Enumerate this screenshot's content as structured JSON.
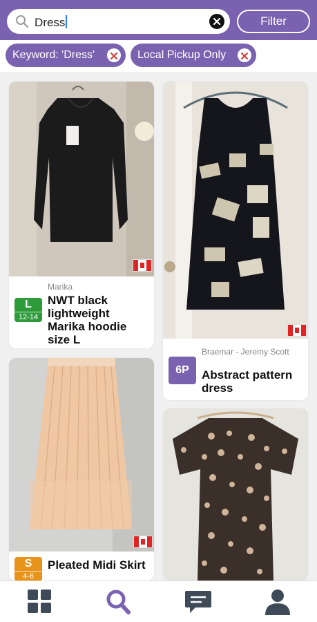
{
  "search": {
    "value": "Dress",
    "filter_label": "Filter"
  },
  "chips": [
    {
      "label": "Keyword: 'Dress'"
    },
    {
      "label": "Local Pickup Only"
    }
  ],
  "listings": [
    {
      "brand": "Marika",
      "title": "NWT black lightweight Marika hoodie size L",
      "size": "L",
      "size_range": "12-14",
      "badge_color": "#2e9b3a",
      "flag": "canada-flag-icon"
    },
    {
      "brand": "Braemar - Jeremy Scott",
      "title": "Abstract pattern dress",
      "size": "6P",
      "badge_color": "#7b62b0",
      "flag": "canada-flag-icon"
    },
    {
      "brand": "",
      "title": "Pleated Midi Skirt",
      "size": "S",
      "size_range": "4-6",
      "badge_color": "#e8941a",
      "flag": "canada-flag-icon"
    },
    {
      "brand": "",
      "title": "",
      "flag": ""
    }
  ],
  "tabs": [
    {
      "icon": "dashboard-icon"
    },
    {
      "icon": "search-icon",
      "active": true
    },
    {
      "icon": "chat-icon"
    },
    {
      "icon": "profile-icon"
    }
  ],
  "colors": {
    "accent": "#7b62b0",
    "canada_red": "#e02424"
  }
}
